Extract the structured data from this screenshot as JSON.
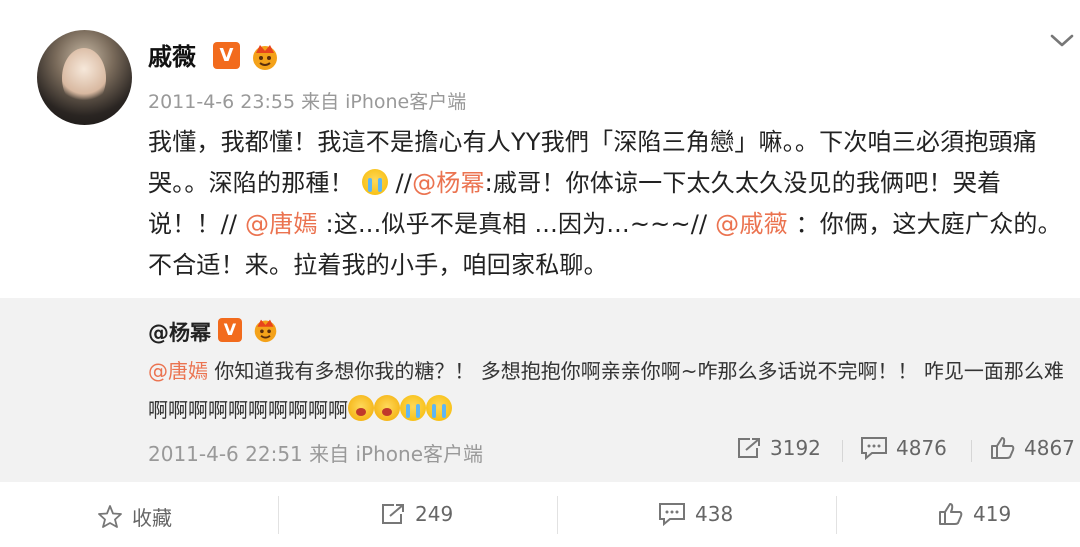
{
  "post": {
    "author": "戚薇",
    "vip_badge": "V",
    "timestamp": "2011-4-6 23:55 来自 iPhone客户端",
    "content": {
      "part1": "我懂，我都懂！我這不是擔心有人YY我們「深陷三角戀」嘛。。下次咱三必須抱頭痛哭。。深陷的那種！",
      "sep1": " //",
      "mention1": "@杨幂",
      "part2": ":戚哥！你体谅一下太久太久没见的我俩吧！哭着说！！// ",
      "mention2": "@唐嫣",
      "part3": " :这...似乎不是真相 ...因为...~~~// ",
      "mention3": "@戚薇",
      "part4": " ：你俩，这大庭广众的。不合适！来。拉着我的小手，咱回家私聊。"
    }
  },
  "repost": {
    "author": "@杨幂",
    "vip_badge": "V",
    "mention": "@唐嫣",
    "text": " 你知道我有多想你我的糖？！ 多想抱抱你啊亲亲你啊~咋那么多话说不完啊！！ 咋见一面那么难啊啊啊啊啊啊啊啊啊啊",
    "timestamp": "2011-4-6 22:51 来自 iPhone客户端",
    "stats": {
      "reposts": "3192",
      "comments": "4876",
      "likes": "4867"
    }
  },
  "actions": {
    "favorite_label": "收藏",
    "reposts": "249",
    "comments": "438",
    "likes": "419"
  },
  "colors": {
    "mention": "#eb7350",
    "vip_badge": "#f26b1d",
    "repost_bg": "#f2f2f2"
  }
}
